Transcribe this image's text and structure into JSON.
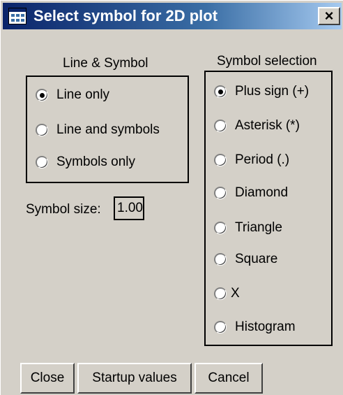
{
  "window": {
    "title": "Select symbol for 2D plot",
    "close_glyph": "×"
  },
  "line_symbol": {
    "label": "Line & Symbol",
    "options": [
      {
        "label": "Line only",
        "checked": true
      },
      {
        "label": "Line and symbols",
        "checked": false
      },
      {
        "label": "Symbols only",
        "checked": false
      }
    ]
  },
  "symbol_selection": {
    "label": "Symbol selection",
    "options": [
      {
        "label": "Plus sign (+)",
        "checked": true
      },
      {
        "label": "Asterisk (*)",
        "checked": false
      },
      {
        "label": "Period (.)",
        "checked": false
      },
      {
        "label": "Diamond",
        "checked": false
      },
      {
        "label": "Triangle",
        "checked": false
      },
      {
        "label": "Square",
        "checked": false
      },
      {
        "label": "X",
        "checked": false
      },
      {
        "label": "Histogram",
        "checked": false
      }
    ]
  },
  "symbol_size": {
    "label": "Symbol size:",
    "value": "1.00"
  },
  "buttons": {
    "close": "Close",
    "startup": "Startup values",
    "cancel": "Cancel"
  },
  "colors": {
    "face": "#d4d0c8",
    "titlebar": "#0a246a",
    "title_text": "#ffffff"
  },
  "icons": {
    "app": "window-app-icon",
    "close": "close-icon"
  }
}
